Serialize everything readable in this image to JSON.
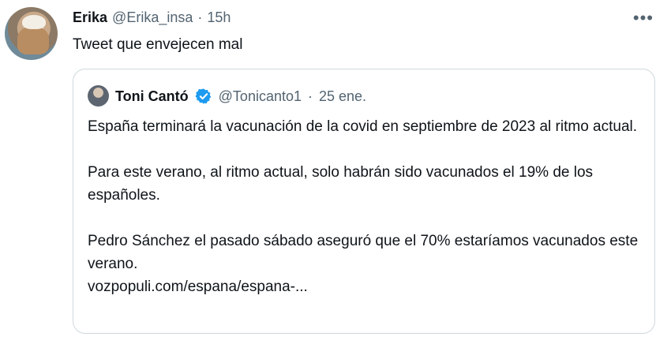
{
  "tweet": {
    "author_name": "Erika",
    "author_handle": "@Erika_insa",
    "separator": "·",
    "time": "15h",
    "more_label": "•••",
    "text": "Tweet que envejecen mal"
  },
  "quoted": {
    "author_name": "Toni Cantó",
    "verified": true,
    "author_handle": "@Tonicanto1",
    "separator": "·",
    "date": "25 ene.",
    "paragraph1": "España terminará la vacunación de la covid en septiembre de 2023 al ritmo actual.",
    "paragraph2": "Para este verano, al ritmo actual, solo habrán sido vacunados el 19% de los españoles.",
    "paragraph3": "Pedro Sánchez el pasado sábado aseguró que el 70% estaríamos vacunados este verano.",
    "link": "vozpopuli.com/espana/espana-..."
  },
  "colors": {
    "text_primary": "#0f1419",
    "text_secondary": "#536471",
    "border": "#cfd9de",
    "verified": "#1d9bf0"
  },
  "icons": {
    "more": "more-horizontal-icon",
    "verified": "verified-badge-icon"
  }
}
